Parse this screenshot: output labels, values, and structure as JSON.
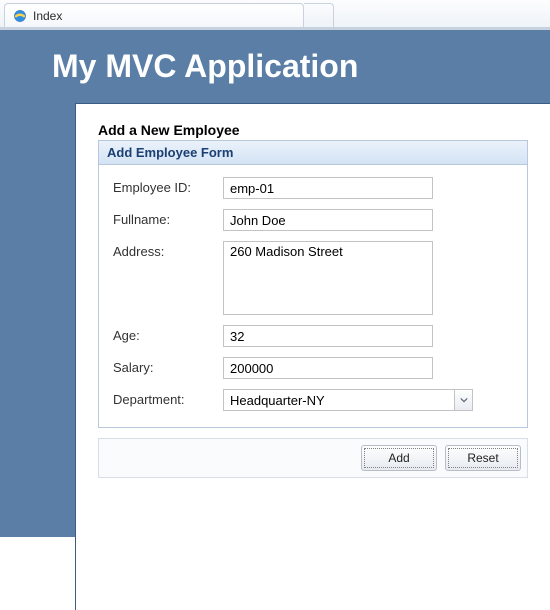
{
  "chrome": {
    "tab_title": "Index"
  },
  "app": {
    "title": "My MVC Application"
  },
  "page": {
    "heading": "Add a New Employee"
  },
  "panel": {
    "title": "Add Employee Form"
  },
  "form": {
    "employee_id": {
      "label": "Employee ID:",
      "value": "emp-01"
    },
    "fullname": {
      "label": "Fullname:",
      "value": "John Doe"
    },
    "address": {
      "label": "Address:",
      "value": "260 Madison Street"
    },
    "age": {
      "label": "Age:",
      "value": "32"
    },
    "salary": {
      "label": "Salary:",
      "value": "200000"
    },
    "department": {
      "label": "Department:",
      "value": "Headquarter-NY"
    }
  },
  "buttons": {
    "add": "Add",
    "reset": "Reset"
  }
}
